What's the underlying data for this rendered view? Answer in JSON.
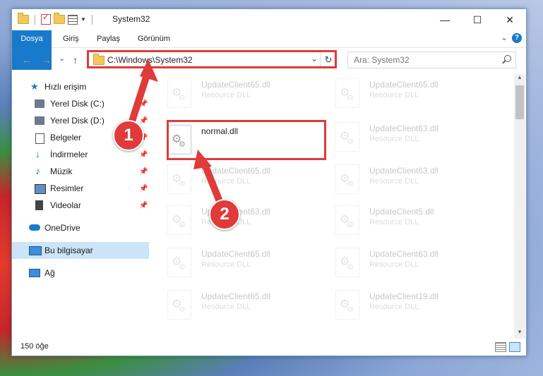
{
  "window": {
    "title": "System32"
  },
  "controls": {
    "minimize": "—",
    "maximize": "☐",
    "close": "✕"
  },
  "ribbon": {
    "tabs": [
      "Dosya",
      "Giriş",
      "Paylaş",
      "Görünüm"
    ],
    "help": "?"
  },
  "nav": {
    "address": "C:\\Windows\\System32",
    "search_placeholder": "Ara: System32",
    "back": "←",
    "forward": "→",
    "recent": "⌄",
    "up": "↑"
  },
  "sidebar": {
    "items": [
      {
        "label": "Hızlı erişim",
        "icon": "star-icon"
      },
      {
        "label": "Yerel Disk (C:)",
        "icon": "drive-icon"
      },
      {
        "label": "Yerel Disk (D:)",
        "icon": "drive-icon"
      },
      {
        "label": "Belgeler",
        "icon": "documents-icon"
      },
      {
        "label": "İndirmeler",
        "icon": "download-icon"
      },
      {
        "label": "Müzik",
        "icon": "music-icon"
      },
      {
        "label": "Resimler",
        "icon": "pictures-icon"
      },
      {
        "label": "Videolar",
        "icon": "videos-icon"
      },
      {
        "label": "OneDrive",
        "icon": "cloud-icon"
      },
      {
        "label": "Bu bilgisayar",
        "icon": "computer-icon"
      },
      {
        "label": "Ağ",
        "icon": "network-icon"
      }
    ]
  },
  "files": [
    {
      "name": "UpdateClient65.dll",
      "type": "Resource DLL"
    },
    {
      "name": "UpdateClient65.dll",
      "type": "Resource DLL"
    },
    {
      "name": "normal.dll",
      "type": ""
    },
    {
      "name": "UpdateClient63.dll",
      "type": "Resource DLL"
    },
    {
      "name": "UpdateClient65.dll",
      "type": "Resource DLL"
    },
    {
      "name": "UpdateClient63.dll",
      "type": "Resource DLL"
    },
    {
      "name": "UpdateClient63.dll",
      "type": "Resource DLL"
    },
    {
      "name": "UpdateClient5.dll",
      "type": "Resource DLL"
    },
    {
      "name": "UpdateClient65.dll",
      "type": "Resource DLL"
    },
    {
      "name": "UpdateClient63.dll",
      "type": "Resource DLL"
    },
    {
      "name": "UpdateClient65.dll",
      "type": "Resource DLL"
    },
    {
      "name": "UpdateClient19.dll",
      "type": "Resource DLL"
    }
  ],
  "status": {
    "count": "150 öğe"
  },
  "markers": [
    "1",
    "2"
  ],
  "colors": {
    "accent": "#1979ca",
    "highlight": "#e03a3a"
  }
}
